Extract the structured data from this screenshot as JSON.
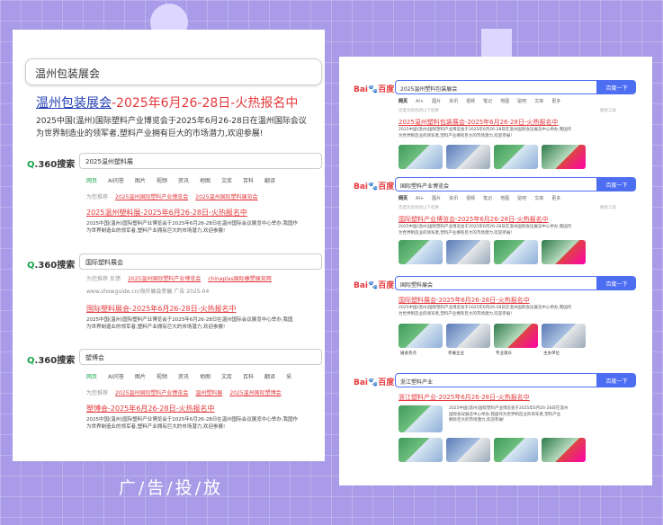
{
  "caption": "广/告/投/放",
  "left_card": {
    "search_query": "温州包装展会",
    "main_result": {
      "title_pre": "温州包装展会",
      "title_post": "-2025年6月26-28日-火热报名中",
      "desc_line1": "2025中国(温州)国际塑料产业博览会于2025年6月26-28日在温州国际会议",
      "desc_line2": "为世界制造业的领军者,塑料产业拥有巨大的市场潜力,欢迎参展!"
    },
    "s360_logo": "360搜索",
    "s360_tabs": [
      "网页",
      "AI问答",
      "图片",
      "视频",
      "资讯",
      "地图",
      "文库",
      "百科",
      "翻译",
      "采"
    ],
    "s360_blocks": [
      {
        "query": "2025温州塑料展",
        "related_label": "为您推荐",
        "related": [
          "2025温州国际塑料产业博览会",
          "2025温州国际塑料展览会"
        ],
        "title": "2025温州塑料展-2025年6月26-28日-火热报名中",
        "desc1": "2025中国(温州)国际塑料产业博览会于2025年6月26-28日在温州国际会议展览中心举办,我国作",
        "desc2": "为世界制造业的领军者,塑料产业拥有巨大的市场潜力,欢迎参展!"
      },
      {
        "query": "国际塑料展会",
        "related_label": "为您推荐",
        "related_extra": "反馈",
        "related": [
          "2025温州国际塑料产业博览会",
          "chinaplas国际橡塑展官网"
        ],
        "ad": "www.showguide.cn/海外展会参展 广告 2025-04",
        "title": "国际塑料展会-2025年6月26-28日-火热报名中",
        "desc1": "2025中国(温州)国际塑料产业博览会于2025年6月26-28日在温州国际会议展览中心举办,我国",
        "desc2": "为世界制造业的领军者,塑料产业拥有巨大的市场潜力,欢迎参展!"
      },
      {
        "query": "塑博会",
        "related_label": "为您推荐",
        "related": [
          "2025温州国际塑料产业博览会",
          "温州塑料展",
          "2025温州国际塑博会"
        ],
        "title": "塑博会-2025年6月26-28日-火热报名中",
        "desc1": "2025中国(温州)国际塑料产业博览会于2025年6月26-28日在温州国际会议展览中心举办,我国作",
        "desc2": "为世界制造业的领军者,塑料产业拥有巨大的市场潜力,欢迎参展!"
      }
    ]
  },
  "right_card": {
    "logo_a": "Bai",
    "logo_b": "百度",
    "button": "百度一下",
    "tabs": [
      "网页",
      "AI+",
      "图片",
      "资讯",
      "视频",
      "笔记",
      "地图",
      "贴吧",
      "文库",
      "更多"
    ],
    "tools": "搜索工具",
    "note": "百度为您找到以下结果",
    "blocks": [
      {
        "query": "2025温州塑料包装展会",
        "title": "2025温州塑料包装展会-2025年6月26-28日-火热报名中",
        "desc1": "2025中国(温州)国际塑料产业博览会于2025年6月26-28日在温州国际会议展览中心举办,我国作",
        "desc2": "为世界制造业的领军者,塑料产业拥有巨大的市场潜力,欢迎参展!"
      },
      {
        "query": "国际塑料产业博览会",
        "title": "国际塑料产业博览会-2025年6月26-28日-火热报名中",
        "desc1": "2025中国(温州)国际塑料产业博览会于2025年6月26-28日在温州国际会议展览中心举办,我国作",
        "desc2": "为世界制造业的领军者,塑料产业拥有巨大的市场潜力,欢迎参展!"
      },
      {
        "query": "国际塑料展会",
        "title": "国际塑料展会-2025年6月26-28日-火热报名中",
        "desc1": "2025中国(温州)国际塑料产业博览会于2025年6月26-28日在温州国际会议展览中心举办,我国作",
        "desc2": "为世界制造业的领军者,塑料产业拥有巨大的市场潜力,欢迎参展!",
        "captions": [
          "展会亮点",
          "参展企业",
          "专业观众",
          "主办单位"
        ]
      },
      {
        "query": "浙江塑料产业",
        "title": "浙江塑料产业-2025年6月26-28日-火热报名中",
        "desc1": "2025中国(温州)国际塑料产业博览会于2025年6月26-28日在温州",
        "desc2": "国际会议展览中心举办,我国作为世界制造业的领军者,塑料产业",
        "desc3": "拥有巨大的市场潜力,欢迎参展!"
      }
    ]
  }
}
